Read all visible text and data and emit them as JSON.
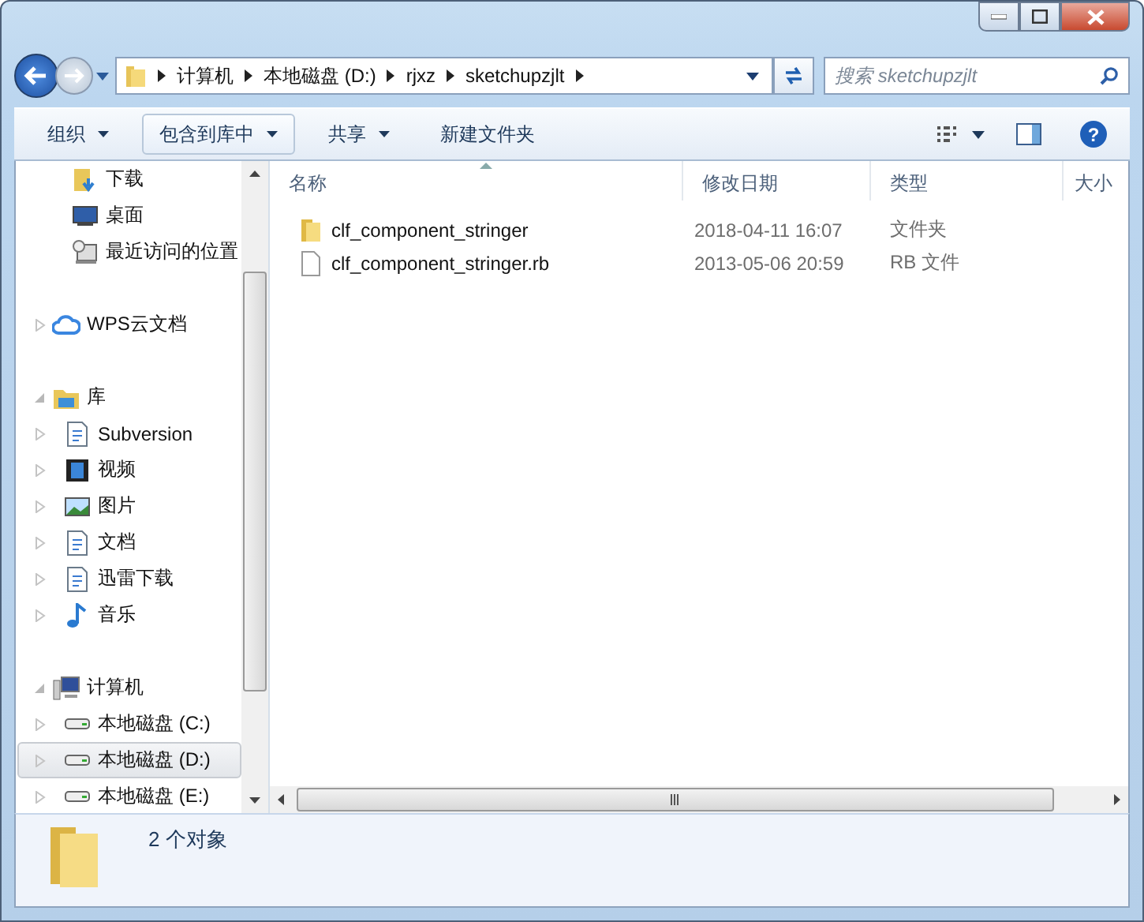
{
  "address": {
    "segments": [
      "计算机",
      "本地磁盘 (D:)",
      "rjxz",
      "sketchupzjlt"
    ]
  },
  "search": {
    "placeholder": "搜索 sketchupzjlt"
  },
  "toolbar": [
    {
      "label": "组织",
      "dropdown": true,
      "selected": false
    },
    {
      "label": "包含到库中",
      "dropdown": true,
      "selected": true
    },
    {
      "label": "共享",
      "dropdown": true,
      "selected": false
    },
    {
      "label": "新建文件夹",
      "dropdown": false,
      "selected": false
    }
  ],
  "nav": [
    {
      "children": [
        {
          "label": "下载",
          "selected": false
        },
        {
          "label": "桌面",
          "selected": false
        },
        {
          "label": "最近访问的位置",
          "selected": false
        }
      ]
    },
    {
      "label": "WPS云文档",
      "expanded": false
    },
    {
      "label": "库",
      "expanded": true,
      "children": [
        {
          "label": "Subversion",
          "selected": false
        },
        {
          "label": "视频",
          "selected": false
        },
        {
          "label": "图片",
          "selected": false
        },
        {
          "label": "文档",
          "selected": false
        },
        {
          "label": "迅雷下载",
          "selected": false
        },
        {
          "label": "音乐",
          "selected": false
        }
      ]
    },
    {
      "label": "计算机",
      "expanded": true,
      "children": [
        {
          "label": "本地磁盘 (C:)",
          "selected": false
        },
        {
          "label": "本地磁盘 (D:)",
          "selected": true
        },
        {
          "label": "本地磁盘 (E:)",
          "selected": false
        }
      ]
    }
  ],
  "table": {
    "columns": [
      "名称",
      "修改日期",
      "类型",
      "大小"
    ],
    "rows": [
      {
        "kind": "folder",
        "name": "clf_component_stringer",
        "date": "2018-04-11 16:07",
        "type": "文件夹"
      },
      {
        "kind": "file",
        "name": "clf_component_stringer.rb",
        "date": "2013-05-06 20:59",
        "type": "RB 文件"
      }
    ]
  },
  "help_button": {
    "label": "?"
  },
  "status_bar": {
    "count": "2 个对象"
  }
}
